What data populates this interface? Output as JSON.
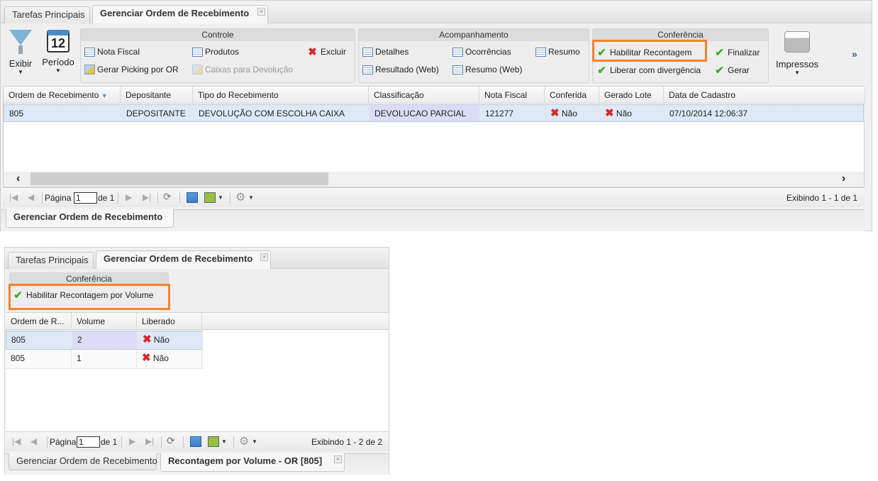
{
  "top": {
    "tabs": [
      {
        "label": "Tarefas Principais"
      },
      {
        "label": "Gerenciar Ordem de Recebimento"
      }
    ],
    "toolbar": {
      "exibir": "Exibir",
      "periodo": "Período",
      "calendar_day": "12",
      "controle": {
        "title": "Controle",
        "nota_fiscal": "Nota Fiscal",
        "produtos": "Produtos",
        "excluir": "Excluir",
        "gerar_picking": "Gerar Picking por OR",
        "caixas_devolucao": "Caixas para Devolução"
      },
      "acompanhamento": {
        "title": "Acompanhamento",
        "detalhes": "Detalhes",
        "ocorrencias": "Ocorrências",
        "resumo": "Resumo",
        "resultado_web": "Resultado (Web)",
        "resumo_web": "Resumo (Web)"
      },
      "conferencia": {
        "title": "Conferência",
        "habilitar": "Habilitar Recontagem",
        "finalizar": "Finalizar",
        "liberar": "Liberar com divergência",
        "gerar": "Gerar"
      },
      "impressos": "Impressos",
      "more": "»"
    },
    "grid": {
      "columns": [
        "Ordem de Recebimento",
        "Depositante",
        "Tipo do Recebimento",
        "Classificação",
        "Nota Fiscal",
        "Conferida",
        "Gerado Lote",
        "Data de Cadastro"
      ],
      "rows": [
        [
          "805",
          "DEPOSITANTE",
          "DEVOLUÇÃO COM ESCOLHA CAIXA",
          "DEVOLUCAO PARCIAL",
          "121277",
          "Não",
          "Não",
          "07/10/2014 12:06:37"
        ]
      ]
    },
    "pager": {
      "page_label": "Página",
      "page_value": "1",
      "of_label": "de 1",
      "display": "Exibindo 1 - 1 de 1"
    },
    "bottom_tabs": [
      {
        "label": "Gerenciar Ordem de Recebimento"
      }
    ]
  },
  "bottom": {
    "tabs": [
      {
        "label": "Tarefas Principais"
      },
      {
        "label": "Gerenciar Ordem de Recebimento"
      }
    ],
    "conferencia": {
      "title": "Conferência",
      "habilitar_volume": "Habilitar Recontagem por Volume"
    },
    "grid": {
      "columns": [
        "Ordem de R...",
        "Volume",
        "Liberado"
      ],
      "rows": [
        [
          "805",
          "2",
          "Não"
        ],
        [
          "805",
          "1",
          "Não"
        ]
      ]
    },
    "pager": {
      "page_label": "Página",
      "page_value": "1",
      "of_label": "de 1",
      "display": "Exibindo 1 - 2 de 2"
    },
    "bottom_tabs": [
      {
        "label": "Gerenciar Ordem de Recebimento"
      },
      {
        "label": "Recontagem por Volume - OR [805]"
      }
    ]
  },
  "colors": {
    "highlight": "#f7812b",
    "selected_row": "#dfe8f6",
    "selected_cell": "#dcdcf8"
  }
}
